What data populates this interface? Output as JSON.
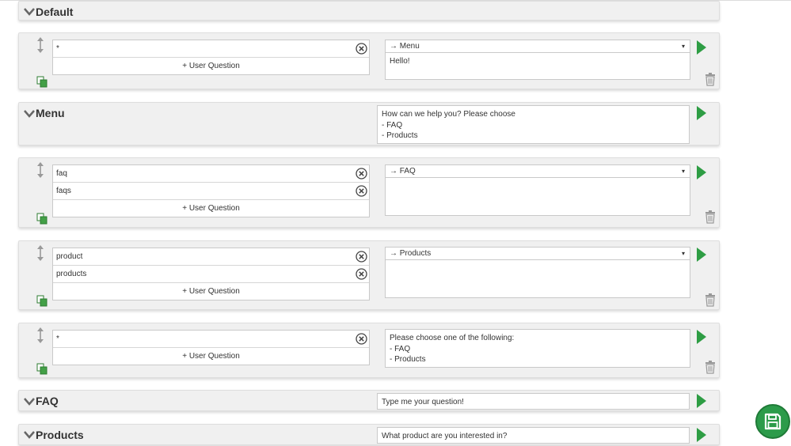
{
  "states": {
    "default": {
      "title": "Default"
    },
    "menu": {
      "title": "Menu",
      "response": "How can we help you? Please choose\n- FAQ\n- Products"
    },
    "faq": {
      "title": "FAQ",
      "response": "Type me your question!"
    },
    "products": {
      "title": "Products",
      "response": "What product are you interested in?"
    }
  },
  "transitions": {
    "default_wild": {
      "questions": [
        "*"
      ],
      "add_label": "+ User Question",
      "target": "→ Menu",
      "response": "Hello!"
    },
    "menu_faq": {
      "questions": [
        "faq",
        "faqs"
      ],
      "add_label": "+ User Question",
      "target": "→ FAQ",
      "response": ""
    },
    "menu_products": {
      "questions": [
        "product",
        "products"
      ],
      "add_label": "+ User Question",
      "target": "→ Products",
      "response": ""
    },
    "menu_wild": {
      "questions": [
        "*"
      ],
      "add_label": "+ User Question",
      "response": "Please choose one of the following:\n- FAQ\n- Products"
    }
  },
  "icons": {
    "expand": "chevron-down-icon",
    "run": "play-icon",
    "clear": "close-circle-icon",
    "sort": "sort-arrows-icon",
    "copy": "copy-icon",
    "delete": "trash-icon",
    "save": "floppy-disk-icon",
    "caret": "▾"
  },
  "colors": {
    "accent": "#2c9b4a",
    "play": "#2e9d44",
    "panel": "#f0f0f0"
  }
}
